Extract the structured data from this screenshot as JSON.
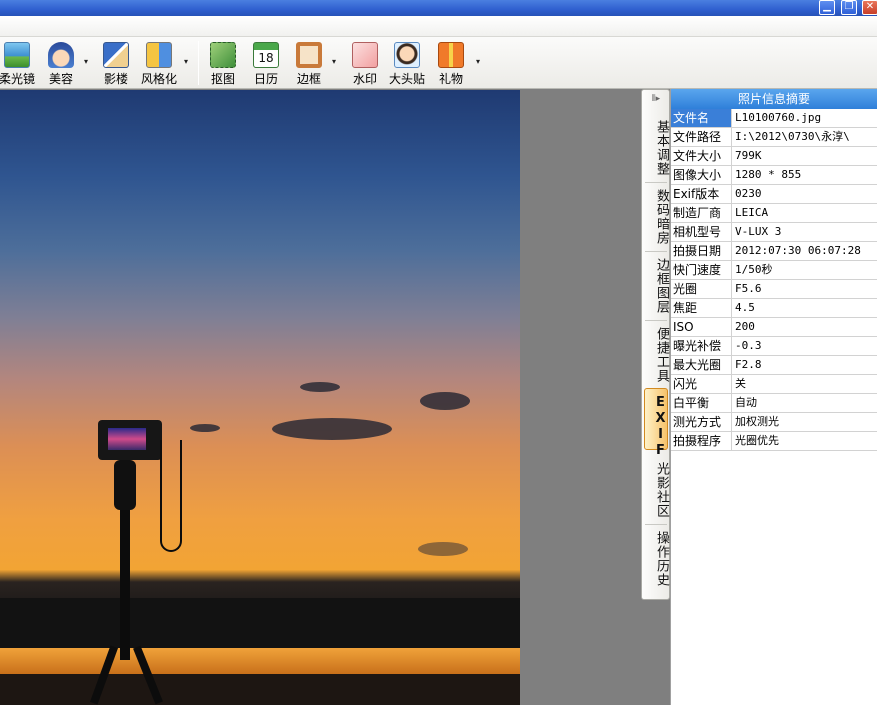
{
  "window": {
    "minimize_glyph": "▁",
    "restore_glyph": "❐",
    "close_glyph": "✕"
  },
  "toolbar": {
    "items": [
      {
        "label": "柔光镜",
        "icon": "soft-light-lens-icon"
      },
      {
        "label": "美容",
        "icon": "beauty-face-icon"
      },
      {
        "label": "影楼",
        "icon": "studio-photo-icon"
      },
      {
        "label": "风格化",
        "icon": "stylize-icon"
      },
      {
        "label": "抠图",
        "icon": "cutout-icon"
      },
      {
        "label": "日历",
        "icon": "calendar-icon",
        "badge": "18"
      },
      {
        "label": "边框",
        "icon": "frame-icon"
      },
      {
        "label": "水印",
        "icon": "watermark-icon"
      },
      {
        "label": "大头贴",
        "icon": "photo-sticker-icon"
      },
      {
        "label": "礼物",
        "icon": "gift-icon"
      }
    ],
    "dropdown_glyph": "▾"
  },
  "sidetabs": {
    "collapse_glyph": "⫴▸",
    "items": [
      {
        "label": "基本调整"
      },
      {
        "label": "数码暗房"
      },
      {
        "label": "边框图层"
      },
      {
        "label": "便捷工具"
      },
      {
        "label": "EXIF",
        "active": true
      },
      {
        "label": "光影社区"
      },
      {
        "label": "操作历史"
      }
    ]
  },
  "exif": {
    "title": "照片信息摘要",
    "rows": [
      {
        "key": "文件名",
        "value": "L10100760.jpg"
      },
      {
        "key": "文件路径",
        "value": "I:\\2012\\0730\\永淳\\"
      },
      {
        "key": "文件大小",
        "value": "799K"
      },
      {
        "key": "图像大小",
        "value": "1280 * 855"
      },
      {
        "key": "Exif版本",
        "value": "0230"
      },
      {
        "key": "制造厂商",
        "value": "LEICA"
      },
      {
        "key": "相机型号",
        "value": "V-LUX 3"
      },
      {
        "key": "拍摄日期",
        "value": "2012:07:30 06:07:28"
      },
      {
        "key": "快门速度",
        "value": "1/50秒"
      },
      {
        "key": "光圈",
        "value": "F5.6"
      },
      {
        "key": "焦距",
        "value": "4.5"
      },
      {
        "key": "ISO",
        "value": "200"
      },
      {
        "key": "曝光补偿",
        "value": "-0.3"
      },
      {
        "key": "最大光圈",
        "value": "F2.8"
      },
      {
        "key": "闪光",
        "value": "关"
      },
      {
        "key": "白平衡",
        "value": "自动"
      },
      {
        "key": "测光方式",
        "value": "加权测光"
      },
      {
        "key": "拍摄程序",
        "value": "光圈优先"
      }
    ]
  }
}
